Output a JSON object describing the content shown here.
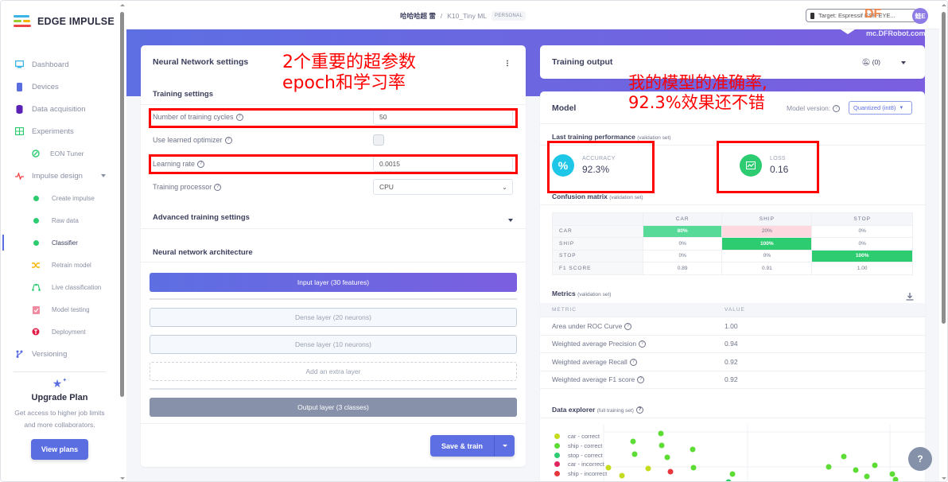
{
  "brand": {
    "name": "EDGE IMPULSE"
  },
  "sidebar": {
    "items": [
      {
        "label": "Dashboard",
        "icon": "monitor-icon"
      },
      {
        "label": "Devices",
        "icon": "chip-icon"
      },
      {
        "label": "Data acquisition",
        "icon": "database-icon"
      },
      {
        "label": "Experiments",
        "icon": "table-icon"
      },
      {
        "label": "EON Tuner",
        "icon": "compass-icon"
      },
      {
        "label": "Impulse design",
        "icon": "pulse-icon"
      },
      {
        "label": "Create impulse",
        "icon": "dot-icon"
      },
      {
        "label": "Raw data",
        "icon": "dot-icon"
      },
      {
        "label": "Classifier",
        "icon": "dot-icon",
        "active": true
      },
      {
        "label": "Retrain model",
        "icon": "shuffle-icon"
      },
      {
        "label": "Live classification",
        "icon": "nodes-icon"
      },
      {
        "label": "Model testing",
        "icon": "clipboard-check-icon"
      },
      {
        "label": "Deployment",
        "icon": "box-icon"
      },
      {
        "label": "Versioning",
        "icon": "branch-icon"
      }
    ],
    "upgrade": {
      "title": "Upgrade Plan",
      "desc": "Get access to higher job limits and more collaborators.",
      "button": "View plans"
    }
  },
  "topbar": {
    "owner": "哈哈哈超 雷",
    "separator": "/",
    "project": "K10_Tiny ML",
    "badge": "PERSONAL",
    "target": "Target: Espressif ESP-EYE...",
    "avatar": "蛙E",
    "watermark_logo": "DF",
    "watermark_url": "mc.DFRobot.com.cn"
  },
  "nn": {
    "title": "Neural Network settings",
    "training_settings": "Training settings",
    "fields": {
      "cycles_label": "Number of training cycles",
      "cycles_value": "50",
      "optimizer_label": "Use learned optimizer",
      "optimizer_checked": false,
      "lr_label": "Learning rate",
      "lr_value": "0.0015",
      "processor_label": "Training processor",
      "processor_value": "CPU"
    },
    "advanced": "Advanced training settings",
    "architecture": "Neural network architecture",
    "layers": {
      "input": "Input layer (30 features)",
      "dense1": "Dense layer (20 neurons)",
      "dense2": "Dense layer (10 neurons)",
      "add": "Add an extra layer",
      "output": "Output layer (3 classes)"
    },
    "save_button": "Save & train"
  },
  "training_output": {
    "title": "Training output",
    "notifications": "(0)"
  },
  "model": {
    "title": "Model",
    "version_label": "Model version:",
    "version_value": "Quantized (int8)",
    "last_perf": "Last training performance",
    "last_perf_note": "(validation set)",
    "accuracy_label": "ACCURACY",
    "accuracy_value": "92.3%",
    "loss_label": "LOSS",
    "loss_value": "0.16",
    "cm_title": "Confusion matrix",
    "cm_note": "(validation set)",
    "cm": {
      "columns": [
        "CAR",
        "SHIP",
        "STOP"
      ],
      "rows": [
        {
          "label": "CAR",
          "values": [
            "80%",
            "20%",
            "0%"
          ]
        },
        {
          "label": "SHIP",
          "values": [
            "0%",
            "100%",
            "0%"
          ]
        },
        {
          "label": "STOP",
          "values": [
            "0%",
            "0%",
            "100%"
          ]
        }
      ],
      "f1_label": "F1 SCORE",
      "f1": [
        "0.89",
        "0.91",
        "1.00"
      ]
    },
    "metrics_title": "Metrics",
    "metrics_note": "(validation set)",
    "metrics_headers": [
      "METRIC",
      "VALUE"
    ],
    "metrics": [
      {
        "name": "Area under ROC Curve",
        "value": "1.00"
      },
      {
        "name": "Weighted average Precision",
        "value": "0.94"
      },
      {
        "name": "Weighted average Recall",
        "value": "0.92"
      },
      {
        "name": "Weighted average F1 score",
        "value": "0.92"
      }
    ],
    "explorer_title": "Data explorer",
    "explorer_note": "(full training set)",
    "legend": [
      {
        "label": "car - correct",
        "color": "#c5dc1e"
      },
      {
        "label": "ship - correct",
        "color": "#5ddc35"
      },
      {
        "label": "stop - correct",
        "color": "#2ecc71"
      },
      {
        "label": "car - incorrect",
        "color": "#e0245e"
      },
      {
        "label": "ship - incorrect",
        "color": "#e8363d"
      }
    ]
  },
  "annotations": {
    "left_line1": "2个重要的超参数",
    "left_line2": "epoch和学习率",
    "right_line1": "我的模型的准确率,",
    "right_line2": "92.3%效果还不错"
  },
  "colors": {
    "accent": "#5d6fe2",
    "accent2": "#7b5fe0",
    "success": "#2ecc71",
    "light_success": "#57d998",
    "danger_light": "#fdd8df",
    "annotation": "#ff0000"
  }
}
